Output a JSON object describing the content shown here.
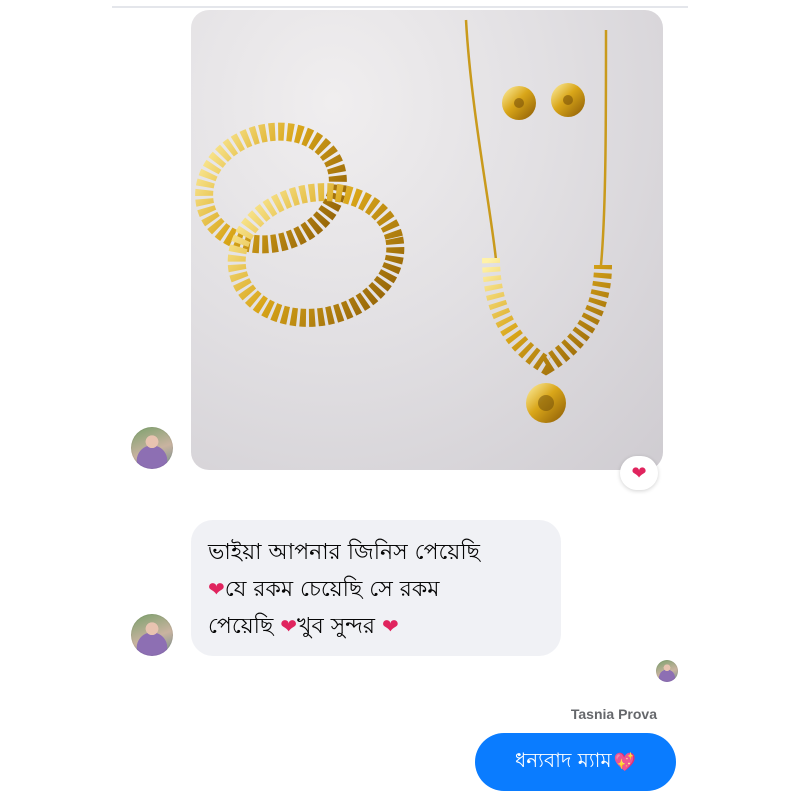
{
  "conversation": {
    "messages": [
      {
        "type": "image",
        "sender": "contact",
        "image_alt": "gold bangles, necklace and earrings",
        "reaction": "❤"
      },
      {
        "type": "text",
        "sender": "contact",
        "lines": [
          "ভাইয়া  আপনার জিনিস পেয়েছি",
          "যে রকম চেয়েছি সে রকম",
          "পেয়েছি ",
          "খুব সুন্দর "
        ],
        "heart": "❤"
      },
      {
        "type": "text",
        "sender": "me",
        "sender_name": "Tasnia Prova",
        "text": "ধন্যবাদ ম্যাম",
        "emoji": "💖"
      }
    ]
  },
  "colors": {
    "outgoing_bubble": "#0a7cff",
    "incoming_bubble": "#f0f1f5",
    "heart": "#e0245e"
  }
}
